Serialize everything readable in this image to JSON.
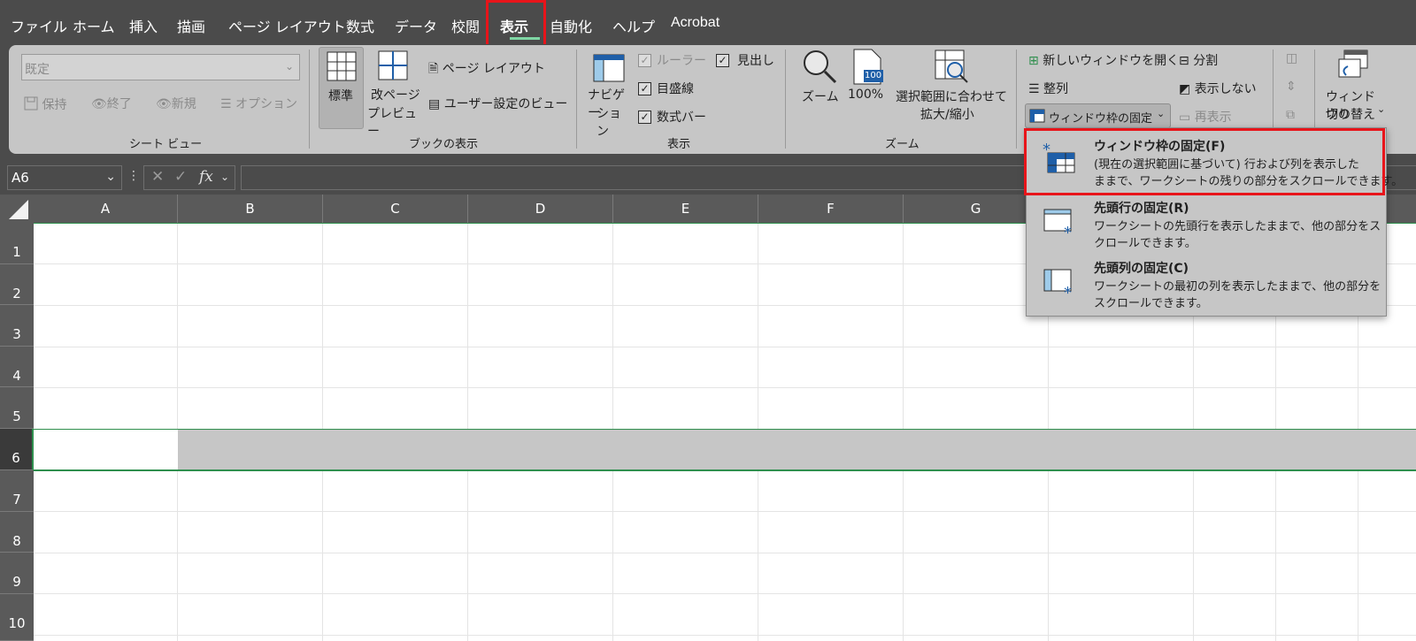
{
  "menu": {
    "tabs": [
      "ファイル",
      "ホーム",
      "挿入",
      "描画",
      "ページ レイアウト",
      "数式",
      "データ",
      "校閲",
      "表示",
      "自動化",
      "ヘルプ",
      "Acrobat"
    ],
    "active_tab": "表示"
  },
  "ribbon": {
    "sheet_view": {
      "dropdown_value": "既定",
      "keep": "保持",
      "exit": "終了",
      "new": "新規",
      "options": "オプション",
      "group_label": "シート ビュー"
    },
    "workbook_views": {
      "normal": "標準",
      "page_break_1": "改ページ",
      "page_break_2": "プレビュー",
      "page_layout": "ページ レイアウト",
      "custom_views": "ユーザー設定のビュー",
      "group_label": "ブックの表示"
    },
    "show": {
      "navigation_1": "ナビゲー",
      "navigation_2": "ション",
      "ruler": "ルーラー",
      "gridlines": "目盛線",
      "formula_bar": "数式バー",
      "headings": "見出し",
      "group_label": "表示"
    },
    "zoom": {
      "zoom": "ズーム",
      "hundred": "100%",
      "hundred_icon": "100",
      "fit_1": "選択範囲に合わせて",
      "fit_2": "拡大/縮小",
      "group_label": "ズーム"
    },
    "window": {
      "new_window": "新しいウィンドウを開く",
      "arrange": "整列",
      "freeze_panes": "ウィンドウ枠の固定",
      "split": "分割",
      "hide": "表示しない",
      "unhide": "再表示",
      "switch_1": "ウィンドウの",
      "switch_2": "切り替え"
    }
  },
  "formula_bar": {
    "name_box": "A6",
    "fx": "fx"
  },
  "grid": {
    "columns": [
      "A",
      "B",
      "C",
      "D",
      "E",
      "F",
      "G"
    ],
    "rows": [
      "1",
      "2",
      "3",
      "4",
      "5",
      "6",
      "7",
      "8",
      "9",
      "10"
    ],
    "selected_row": "6"
  },
  "freeze_menu": {
    "items": [
      {
        "title": "ウィンドウ枠の固定(F)",
        "desc1": "(現在の選択範囲に基づいて) 行および列を表示した",
        "desc2": "ままで、ワークシートの残りの部分をスクロールできます。"
      },
      {
        "title": "先頭行の固定(R)",
        "desc1": "ワークシートの先頭行を表示したままで、他の部分をス",
        "desc2": "クロールできます。"
      },
      {
        "title": "先頭列の固定(C)",
        "desc1": "ワークシートの最初の列を表示したままで、他の部分を",
        "desc2": "スクロールできます。"
      }
    ]
  },
  "colors": {
    "highlight": "#e8141a",
    "selection_green": "#2f8f4e",
    "accent_blue": "#1f5fa8"
  }
}
